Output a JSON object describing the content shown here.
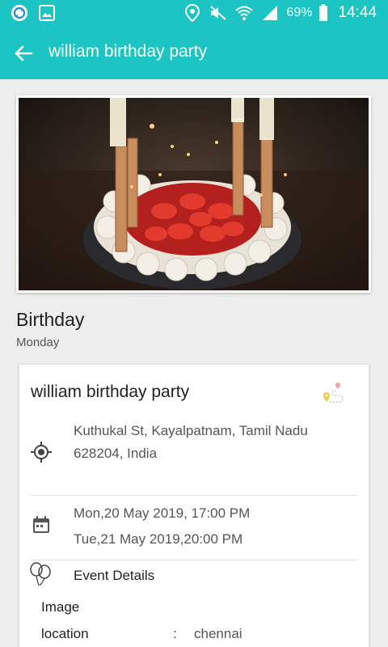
{
  "status_bar": {
    "battery": "69%",
    "time": "14:44",
    "left_icons": [
      "sync-icon",
      "image-icon"
    ],
    "right_icons": [
      "location-icon",
      "mute-icon",
      "wifi-icon",
      "signal-icon",
      "battery-icon"
    ]
  },
  "app_bar": {
    "title": "william birthday party",
    "color": "#1cc4c4"
  },
  "event": {
    "type": "Birthday",
    "day": "Monday"
  },
  "card": {
    "title": "william birthday party",
    "address_line1": "Kuthukal St, Kayalpatnam, Tamil Nadu",
    "address_line2": "628204, India",
    "start": "Mon,20 May 2019, 17:00 PM",
    "end": "Tue,21 May 2019,20:00 PM",
    "details_label": "Event Details",
    "details": [
      {
        "key": "Image",
        "value": ""
      },
      {
        "key": "location",
        "sep": ":",
        "value": "chennai"
      }
    ]
  }
}
